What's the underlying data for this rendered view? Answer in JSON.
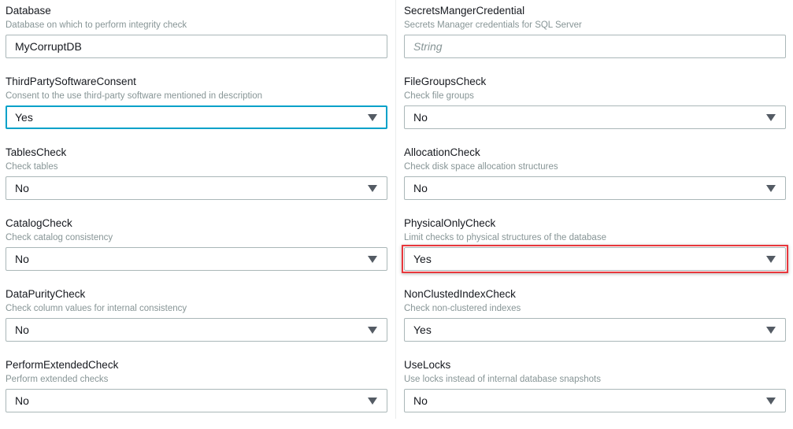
{
  "left": [
    {
      "label": "Database",
      "description": "Database on which to perform integrity check",
      "value": "MyCorruptDB",
      "type": "text"
    },
    {
      "label": "ThirdPartySoftwareConsent",
      "description": "Consent to the use third-party software mentioned in description",
      "value": "Yes",
      "type": "select"
    },
    {
      "label": "TablesCheck",
      "description": "Check tables",
      "value": "No",
      "type": "select"
    },
    {
      "label": "CatalogCheck",
      "description": "Check catalog consistency",
      "value": "No",
      "type": "select"
    },
    {
      "label": "DataPurityCheck",
      "description": "Check column values for internal consistency",
      "value": "No",
      "type": "select"
    },
    {
      "label": "PerformExtendedCheck",
      "description": "Perform extended checks",
      "value": "No",
      "type": "select"
    }
  ],
  "right": [
    {
      "label": "SecretsMangerCredential",
      "description": "Secrets Manager credentials for SQL Server",
      "placeholder": "String",
      "type": "text"
    },
    {
      "label": "FileGroupsCheck",
      "description": "Check file groups",
      "value": "No",
      "type": "select"
    },
    {
      "label": "AllocationCheck",
      "description": "Check disk space allocation structures",
      "value": "No",
      "type": "select"
    },
    {
      "label": "PhysicalOnlyCheck",
      "description": "Limit checks to physical structures of the database",
      "value": "Yes",
      "type": "select"
    },
    {
      "label": "NonClustedIndexCheck",
      "description": "Check non-clustered indexes",
      "value": "Yes",
      "type": "select"
    },
    {
      "label": "UseLocks",
      "description": "Use locks instead of internal database snapshots",
      "value": "No",
      "type": "select"
    }
  ],
  "colors": {
    "focus": "#00a1c9",
    "highlight": "#e8373c"
  }
}
